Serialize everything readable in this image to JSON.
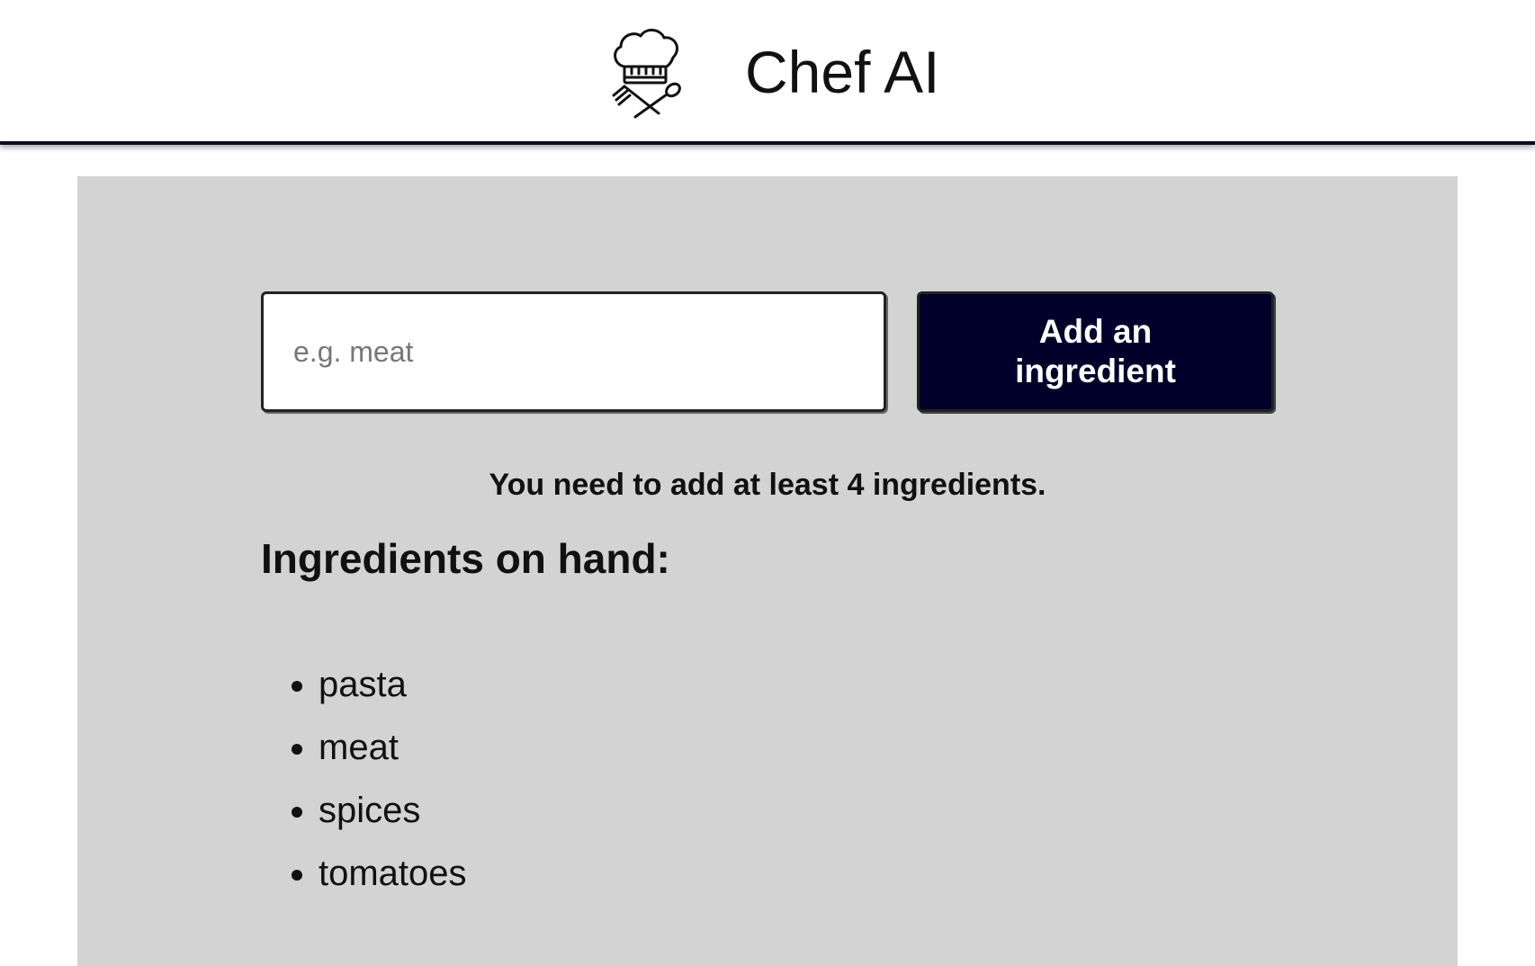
{
  "header": {
    "title": "Chef AI",
    "logo_icon": "chef-hat-utensils-icon"
  },
  "form": {
    "input_placeholder": "e.g. meat",
    "input_value": "",
    "button_label": "Add an ingredient"
  },
  "hint": "You need to add at least 4 ingredients.",
  "ingredients": {
    "title": "Ingredients on hand:",
    "items": [
      "pasta",
      "meat",
      "spices",
      "tomatoes"
    ]
  },
  "colors": {
    "button_bg": "#00002a",
    "panel_bg": "#d3d3d3",
    "header_border": "#0b0b2a"
  }
}
